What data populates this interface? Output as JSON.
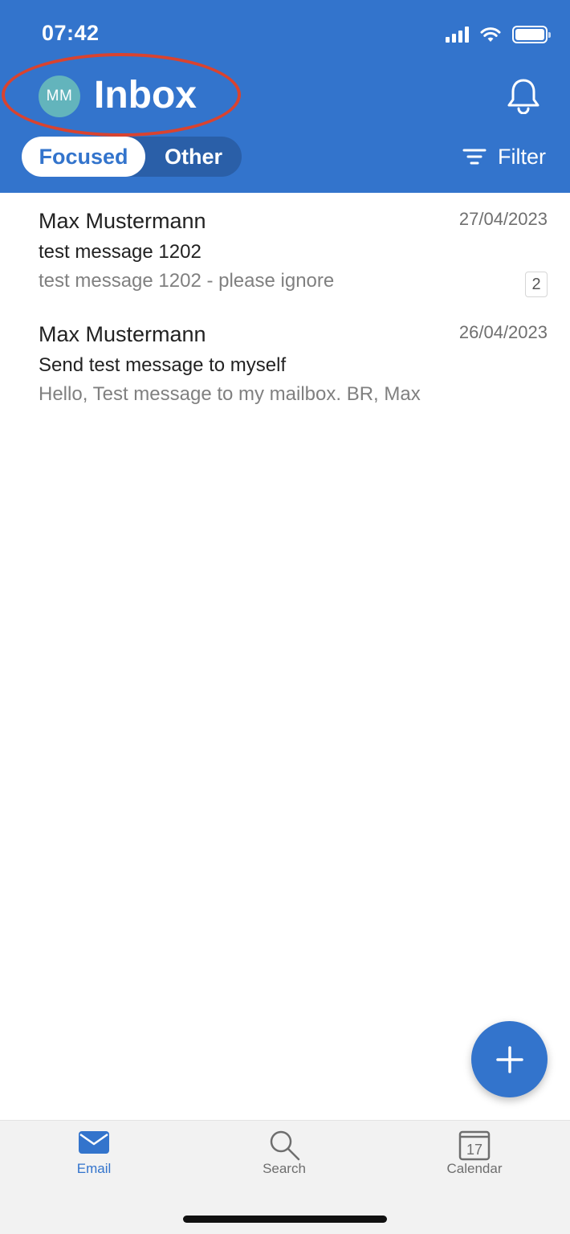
{
  "status_bar": {
    "time": "07:42"
  },
  "header": {
    "avatar_initials": "MM",
    "title": "Inbox",
    "tabs": [
      {
        "label": "Focused",
        "selected": true
      },
      {
        "label": "Other",
        "selected": false
      }
    ],
    "filter_label": "Filter"
  },
  "messages": [
    {
      "sender": "Max Mustermann",
      "date": "27/04/2023",
      "subject": "test message 1202",
      "preview": "test message 1202 - please ignore",
      "thread_count": "2"
    },
    {
      "sender": "Max Mustermann",
      "date": "26/04/2023",
      "subject": "Send test message to myself",
      "preview": "Hello, Test message to my mailbox. BR, Max"
    }
  ],
  "tabbar": {
    "items": [
      {
        "label": "Email",
        "icon": "mail-icon",
        "active": true
      },
      {
        "label": "Search",
        "icon": "search-icon",
        "active": false
      },
      {
        "label": "Calendar",
        "icon": "calendar-icon",
        "active": false,
        "icon_text": "17"
      }
    ]
  },
  "colors": {
    "brand_blue": "#3374cc",
    "avatar": "#63b4bc",
    "highlight_ring": "#d9432f",
    "tab_active": "#3374cc",
    "tab_inactive": "#6e6e6e"
  }
}
